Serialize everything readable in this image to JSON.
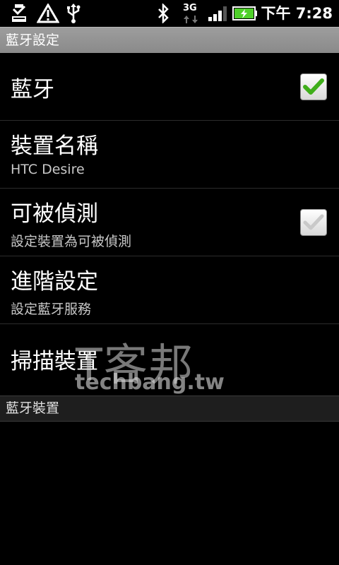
{
  "status_bar": {
    "time": "下午 7:28",
    "icons": [
      "download-icon",
      "warning-icon",
      "usb-icon",
      "bluetooth-icon",
      "3g-icon",
      "signal-icon",
      "battery-charging-icon"
    ],
    "network_label": "3G"
  },
  "title_bar": {
    "title": "藍牙設定"
  },
  "preferences": [
    {
      "title": "藍牙",
      "summary": "",
      "checkbox": true,
      "checked": true
    },
    {
      "title": "裝置名稱",
      "summary": "HTC Desire",
      "checkbox": false
    },
    {
      "title": "可被偵測",
      "summary": "設定裝置為可被偵測",
      "checkbox": true,
      "checked": false
    },
    {
      "title": "進階設定",
      "summary": "設定藍牙服務",
      "checkbox": false
    },
    {
      "title": "掃描裝置",
      "summary": "",
      "checkbox": false
    }
  ],
  "watermark": {
    "chinese": "T客邦",
    "english": "techbang.tw"
  },
  "category": {
    "label": "藍牙裝置"
  },
  "colors": {
    "check_green": "#3fae1a",
    "check_gray": "#c9c9c9",
    "battery_green": "#4fd02a"
  }
}
